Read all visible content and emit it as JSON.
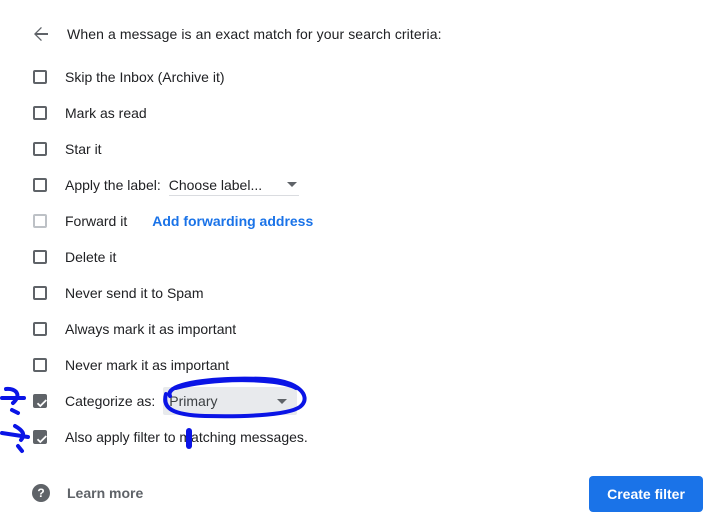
{
  "header": {
    "back_icon": "arrow-left-icon",
    "title": "When a message is an exact match for your search criteria:"
  },
  "options": {
    "skip_inbox": {
      "label": "Skip the Inbox (Archive it)",
      "checked": false
    },
    "mark_read": {
      "label": "Mark as read",
      "checked": false
    },
    "star": {
      "label": "Star it",
      "checked": false
    },
    "apply_label": {
      "label": "Apply the label:",
      "select_value": "Choose label...",
      "checked": false
    },
    "forward": {
      "label": "Forward it",
      "link": "Add forwarding address",
      "checked": false,
      "disabled": true
    },
    "delete": {
      "label": "Delete it",
      "checked": false
    },
    "never_spam": {
      "label": "Never send it to Spam",
      "checked": false
    },
    "always_important": {
      "label": "Always mark it as important",
      "checked": false
    },
    "never_important": {
      "label": "Never mark it as important",
      "checked": false
    },
    "categorize": {
      "label": "Categorize as:",
      "select_value": "Primary",
      "checked": true
    },
    "also_apply": {
      "label": "Also apply filter to matching messages.",
      "checked": true
    }
  },
  "footer": {
    "help_icon": "question-mark-icon",
    "learn_more": "Learn more",
    "create_button": "Create filter"
  },
  "colors": {
    "accent": "#1a73e8",
    "annotation": "#0a14e6",
    "checkbox": "#5f6368"
  }
}
